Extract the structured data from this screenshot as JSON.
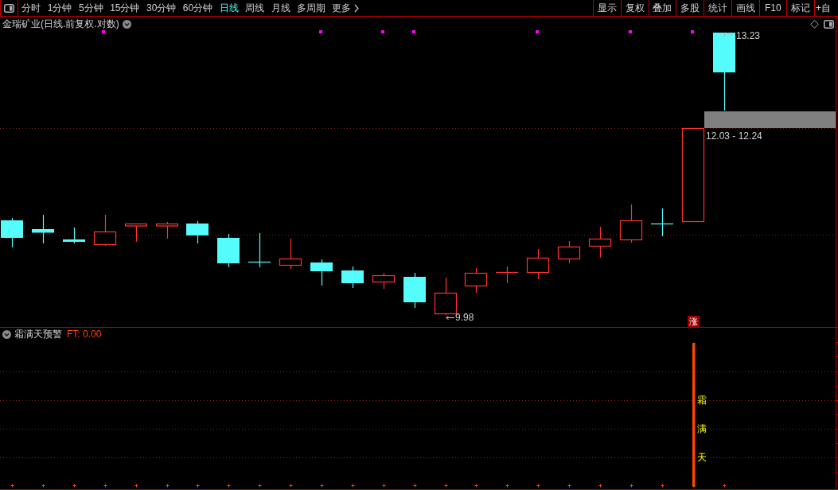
{
  "toolbar": {
    "periods": [
      {
        "label": "分时",
        "selected": false
      },
      {
        "label": "1分钟",
        "selected": false
      },
      {
        "label": "5分钟",
        "selected": false
      },
      {
        "label": "15分钟",
        "selected": false
      },
      {
        "label": "30分钟",
        "selected": false
      },
      {
        "label": "60分钟",
        "selected": false
      },
      {
        "label": "日线",
        "selected": true
      },
      {
        "label": "周线",
        "selected": false
      },
      {
        "label": "月线",
        "selected": false
      },
      {
        "label": "多周期",
        "selected": false
      }
    ],
    "more_button": {
      "label": "更多"
    },
    "tools": [
      "显示",
      "复权",
      "叠加",
      "多股",
      "统计",
      "画线",
      "F10",
      "标记",
      "+自"
    ]
  },
  "main_chart": {
    "title": "金瑞矿业(日线.前复权.对数)",
    "high_label": "13.23",
    "low_label": "9.98",
    "range_label": "12.03 - 12.24",
    "badge": "涨"
  },
  "indicator": {
    "name": "霜满天预警",
    "value": "FT: 0.00",
    "signal": "霜满天"
  }
}
